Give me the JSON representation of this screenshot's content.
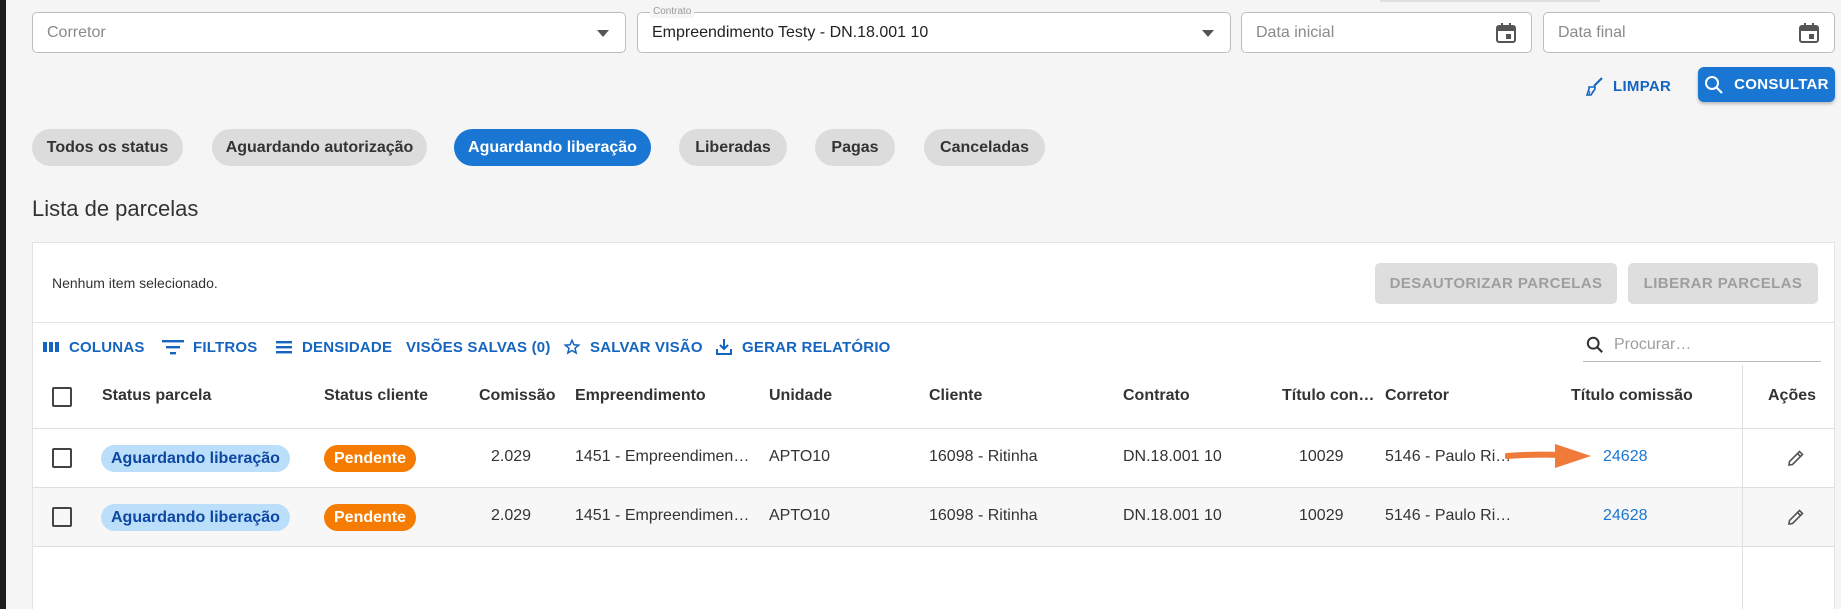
{
  "filters": {
    "corretor_placeholder": "Corretor",
    "contrato_label": "Contrato",
    "contrato_value": "Empreendimento Testy - DN.18.001 10",
    "data_inicial_placeholder": "Data inicial",
    "data_final_placeholder": "Data final"
  },
  "actions": {
    "clear_label": "LIMPAR",
    "consult_label": "CONSULTAR"
  },
  "status_chips": [
    {
      "label": "Todos os status",
      "active": false
    },
    {
      "label": "Aguardando autorização",
      "active": false
    },
    {
      "label": "Aguardando liberação",
      "active": true
    },
    {
      "label": "Liberadas",
      "active": false
    },
    {
      "label": "Pagas",
      "active": false
    },
    {
      "label": "Canceladas",
      "active": false
    }
  ],
  "list": {
    "title": "Lista de parcelas",
    "selection_text": "Nenhum item selecionado.",
    "btn_unauthorize": "DESAUTORIZAR PARCELAS",
    "btn_release": "LIBERAR PARCELAS"
  },
  "toolbar": {
    "columns": "COLUNAS",
    "filters": "FILTROS",
    "density": "DENSIDADE",
    "saved_views": "VISÕES SALVAS (0)",
    "save_view": "SALVAR VISÃO",
    "report": "GERAR RELATÓRIO",
    "search_placeholder": "Procurar…"
  },
  "table": {
    "headers": [
      "Status parcela",
      "Status cliente",
      "Comissão",
      "Empreendimento",
      "Unidade",
      "Cliente",
      "Contrato",
      "Título con…",
      "Corretor",
      "Título comissão",
      "Ações"
    ],
    "rows": [
      [
        "Aguardando liberação",
        "Pendente",
        "2.029",
        "1451 - Empreendimen…",
        "APTO10",
        "16098 - Ritinha",
        "DN.18.001 10",
        "10029",
        "5146 - Paulo Ri…",
        "24628"
      ],
      [
        "Aguardando liberação",
        "Pendente",
        "2.029",
        "1451 - Empreendimen…",
        "APTO10",
        "16098 - Ritinha",
        "DN.18.001 10",
        "10029",
        "5146 - Paulo Ri…",
        "24628"
      ]
    ]
  },
  "colors": {
    "primary": "#1976d2",
    "badge_blue_bg": "#bbdefb",
    "badge_orange": "#f57c00",
    "annotation_arrow": "#f07a3a"
  }
}
